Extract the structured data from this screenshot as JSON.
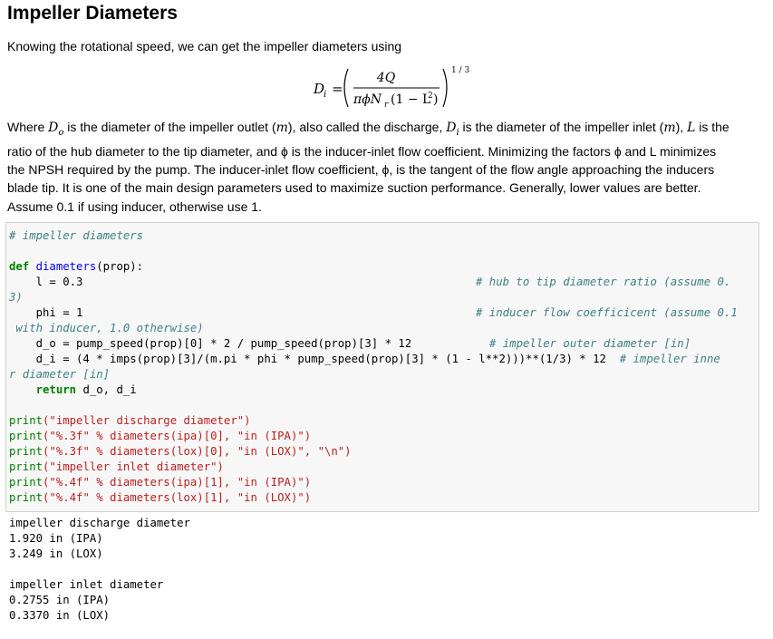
{
  "heading": "Impeller Diameters",
  "intro": "Knowing the rotational speed, we can get the impeller diameters using",
  "equation": {
    "lhs": "D",
    "lhs_sub": "i",
    "numerator": "4Q",
    "denominator": "πϕN",
    "denominator_sub": "r",
    "denominator_tail": "(1 − L",
    "denominator_sup": "2",
    "exponent": "1 / 3"
  },
  "paragraph_lines": [
    "Where D_o is the diameter of the impeller outlet (m), also called the discharge, D_i is the diameter of the impeller inlet (m), L is the",
    "ratio of the hub diameter to the tip diameter, and ϕ is the inducer-inlet flow coefficient. Minimizing the factors ϕ and L minimizes",
    "the NPSH required by the pump. The inducer-inlet flow coefficient, ϕ, is the tangent of the flow angle approaching the inducers",
    "blade tip. It is one of the main design parameters used to maximize suction performance. Generally, lower values are better.",
    "Assume 0.1 if using inducer, otherwise use 1."
  ],
  "code": {
    "comment_header": "# impeller diameters",
    "def_kw": "def",
    "func_name": "diameters",
    "func_sig": "(prop):",
    "l_line": "    l = 0.3",
    "l_comment": "# hub to tip diameter ratio (assume 0.",
    "l_wrap": "3)",
    "phi_line": "    phi = 1",
    "phi_comment": "# inducer flow coefficicent (assume 0.1",
    "phi_wrap": " with inducer, 1.0 otherwise)",
    "do_line": "    d_o = pump_speed(prop)[0] * 2 / pump_speed(prop)[3] * 12",
    "do_comment": "# impeller outer diameter [in]",
    "di_line": "    d_i = (4 * imps(prop)[3]/(m.pi * phi * pump_speed(prop)[3] * (1 - l**2)))**(1/3) * 12",
    "di_comment": "# impeller inne",
    "di_wrap": "r diameter [in]",
    "return_kw": "return",
    "return_rest": " d_o, d_i",
    "print_lines": [
      {
        "fn": "print",
        "args": "(\"impeller discharge diameter\")"
      },
      {
        "fn": "print",
        "args": "(\"%.3f\" % diameters(ipa)[0], \"in (IPA)\")"
      },
      {
        "fn": "print",
        "args": "(\"%.3f\" % diameters(lox)[0], \"in (LOX)\", \"\\n\")"
      },
      {
        "fn": "print",
        "args": "(\"impeller inlet diameter\")"
      },
      {
        "fn": "print",
        "args": "(\"%.4f\" % diameters(ipa)[1], \"in (IPA)\")"
      },
      {
        "fn": "print",
        "args": "(\"%.4f\" % diameters(lox)[1], \"in (LOX)\")"
      }
    ]
  },
  "output_lines": [
    "impeller discharge diameter",
    "1.920 in (IPA)",
    "3.249 in (LOX)",
    "",
    "impeller inlet diameter",
    "0.2755 in (IPA)",
    "0.3370 in (LOX)"
  ]
}
